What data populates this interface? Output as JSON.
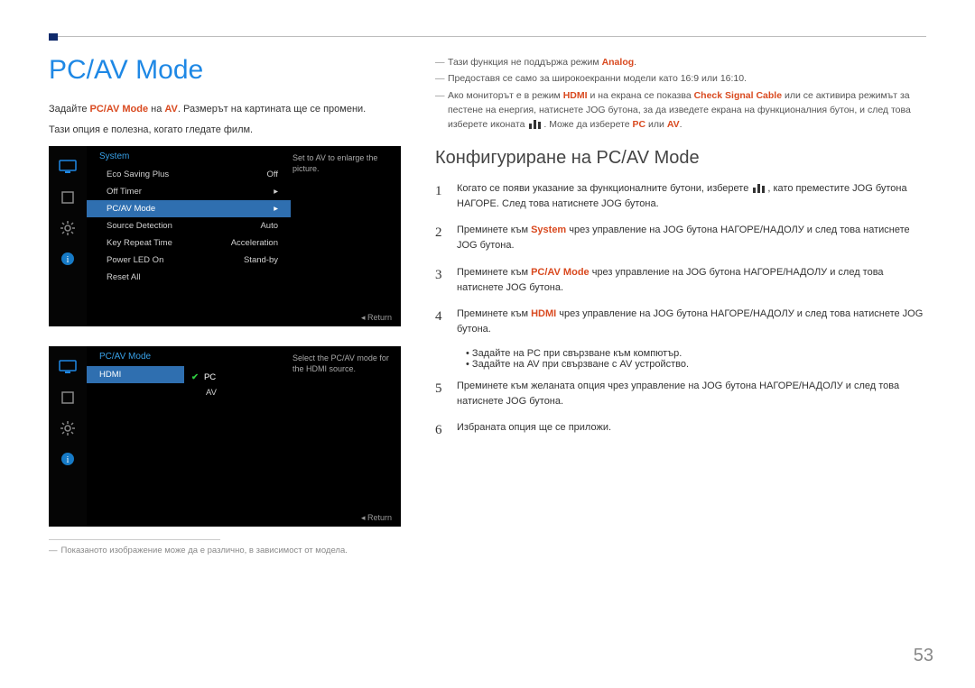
{
  "page_number": "53",
  "left": {
    "title": "PC/AV Mode",
    "p1_a": "Задайте ",
    "p1_b": "PC/AV Mode",
    "p1_c": " на ",
    "p1_d": "AV",
    "p1_e": ". Размерът на картината ще се промени.",
    "p2": "Тази опция е полезна, когато гледате филм.",
    "footnote_dash": "―",
    "footnote": "Показаното изображение може да е различно, в зависимост от модела."
  },
  "osd1": {
    "heading": "System",
    "hint": "Set to AV to enlarge the picture.",
    "return": "Return",
    "rows": [
      {
        "label": "Eco Saving Plus",
        "value": "Off"
      },
      {
        "label": "Off Timer",
        "value": "▸"
      },
      {
        "label": "PC/AV Mode",
        "value": "▸",
        "selected": true
      },
      {
        "label": "Source Detection",
        "value": "Auto"
      },
      {
        "label": "Key Repeat Time",
        "value": "Acceleration"
      },
      {
        "label": "Power LED On",
        "value": "Stand-by"
      },
      {
        "label": "Reset All",
        "value": ""
      }
    ]
  },
  "osd2": {
    "heading": "PC/AV Mode",
    "hint": "Select the PC/AV mode for the HDMI source.",
    "return": "Return",
    "row_label": "HDMI",
    "options": [
      {
        "label": "PC",
        "selected": true
      },
      {
        "label": "AV",
        "selected": false
      }
    ]
  },
  "right": {
    "notes": {
      "dash": "―",
      "n1_a": "Тази функция не поддържа режим ",
      "n1_b": "Analog",
      "n1_c": ".",
      "n2": "Предоставя се само за широкоекранни модели като 16:9 или 16:10.",
      "n3_a": "Ако мониторът е в режим ",
      "n3_b": "HDMI",
      "n3_c": " и на екрана се показва ",
      "n3_d": "Check Signal Cable",
      "n3_e": " или се активира режимът за пестене на енергия, натиснете JOG бутона, за да изведете екрана на функционалния бутон, и след това изберете иконата ",
      "n3_f": ". Може да изберете ",
      "n3_g": "PC",
      "n3_h": " или ",
      "n3_i": "AV",
      "n3_j": "."
    },
    "h2": "Конфигуриране на PC/AV Mode",
    "steps": {
      "s1_a": "Когато се появи указание за функционалните бутони, изберете ",
      "s1_b": ", като преместите JOG бутона НАГОРЕ. След това натиснете JOG бутона.",
      "s2_a": "Преминете към ",
      "s2_b": "System",
      "s2_c": " чрез управление на JOG бутона НАГОРЕ/НАДОЛУ и след това натиснете JOG бутона.",
      "s3_a": "Преминете към ",
      "s3_b": "PC/AV Mode",
      "s3_c": " чрез управление на JOG бутона НАГОРЕ/НАДОЛУ и след това натиснете JOG бутона.",
      "s4_a": "Преминете към ",
      "s4_b": "HDMI",
      "s4_c": " чрез управление на JOG бутона НАГОРЕ/НАДОЛУ и след това натиснете JOG бутона.",
      "bul1": "Задайте на PC при свързване към компютър.",
      "bul2": "Задайте на AV при свързване с AV устройство.",
      "s5": "Преминете към желаната опция чрез управление на JOG бутона НАГОРЕ/НАДОЛУ и след това натиснете JOG бутона.",
      "s6": "Избраната опция ще се приложи."
    },
    "nums": {
      "n1": "1",
      "n2": "2",
      "n3": "3",
      "n4": "4",
      "n5": "5",
      "n6": "6"
    }
  }
}
